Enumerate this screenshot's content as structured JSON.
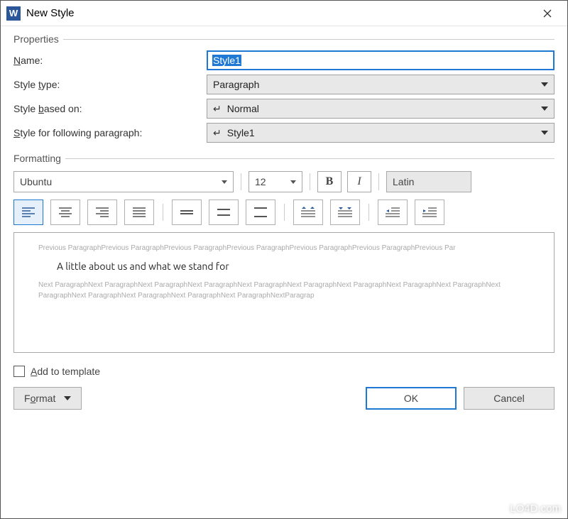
{
  "titlebar": {
    "title": "New Style",
    "app_letter": "W"
  },
  "groups": {
    "properties": "Properties",
    "formatting": "Formatting"
  },
  "properties": {
    "name_label": "Name:",
    "name_accel": "N",
    "name_value": "Style1",
    "type_label": "Style type:",
    "type_accel": "t",
    "type_value": "Paragraph",
    "based_label": "Style based on:",
    "based_accel": "b",
    "based_value": "Normal",
    "follow_label": "Style for following paragraph:",
    "follow_accel": "S",
    "follow_value": "Style1"
  },
  "formatting": {
    "font_name": "Ubuntu",
    "font_size": "12",
    "bold": "B",
    "italic": "I",
    "script": "Latin"
  },
  "preview": {
    "prev": "Previous ParagraphPrevious ParagraphPrevious ParagraphPrevious ParagraphPrevious ParagraphPrevious ParagraphPrevious Par",
    "sample": "A little about us and what we stand for",
    "next": "Next ParagraphNext ParagraphNext ParagraphNext ParagraphNext ParagraphNext ParagraphNext ParagraphNext ParagraphNext ParagraphNext ParagraphNext ParagraphNext ParagraphNext ParagraphNext ParagraphNextParagrap"
  },
  "add_tpl_label": "Add to template",
  "add_tpl_accel": "A",
  "buttons": {
    "format": "Format",
    "ok": "OK",
    "cancel": "Cancel"
  },
  "watermark": "LO4D.com"
}
